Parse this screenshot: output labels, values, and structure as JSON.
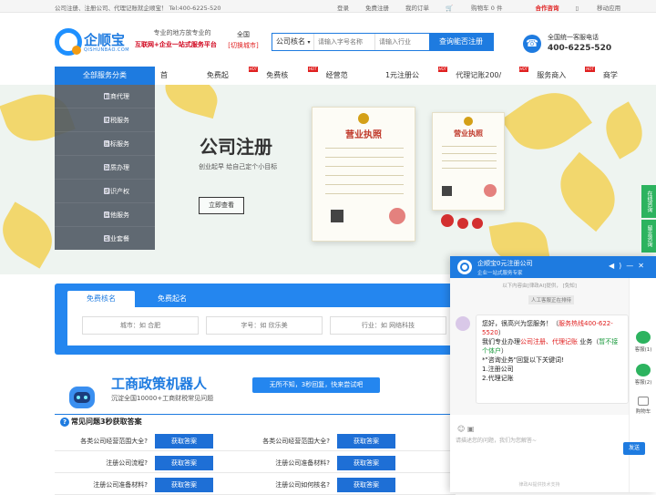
{
  "topbar": {
    "welcome": "公司注册、注册公司、代理记账就企顺宝！ Tel:400-6225-520",
    "links": [
      "登录",
      "免费注册",
      "我的订单",
      "购物车 0 件",
      "合作咨询",
      "移动应用"
    ]
  },
  "header": {
    "logo_title": "企顺宝",
    "logo_sub": "QISHUNBAO.COM",
    "slogan1": "专业的地方放专业的",
    "slogan2_red": "互联网+企业一站式服务平台",
    "city_name": "全国",
    "city_switch": "[切换城市]",
    "search_select": "公司核名",
    "search_ph1": "请输入字号名称",
    "search_ph2": "请输入行业",
    "search_btn": "查询能否注册",
    "phone_label": "全国统一客服电话",
    "phone_number": "400-6225-520"
  },
  "nav": {
    "category": "全部服务分类",
    "items": [
      {
        "label": "首页",
        "hot": ""
      },
      {
        "label": "免费起名",
        "hot": "HOT"
      },
      {
        "label": "免费核名",
        "hot": "HOT"
      },
      {
        "label": "经营范围",
        "hot": ""
      },
      {
        "label": "1元注册公司",
        "hot": "HOT"
      },
      {
        "label": "代理记账200/月",
        "hot": "HOT"
      },
      {
        "label": "服务商入口",
        "hot": "HOT"
      },
      {
        "label": "商学院",
        "hot": ""
      }
    ]
  },
  "sidemenu": [
    "工商代理",
    "财税服务",
    "商标服务",
    "资质办理",
    "知识产权",
    "其他服务",
    "创业套餐"
  ],
  "banner": {
    "title": "公司注册",
    "subtitle": "创业起早  给自己定个小目标",
    "button": "立即查看",
    "license_title": "营业执照"
  },
  "right_tabs": [
    "在线咨询",
    "留言咨询"
  ],
  "form": {
    "tabs": [
      "免费核名",
      "免费起名"
    ],
    "field1": "城市：如 合肥",
    "field2": "字号：如 欣乐美",
    "field3": "行业：如 网络科技",
    "field4": "有限"
  },
  "policy": {
    "title": "工商政策机器人",
    "subtitle": "沉淀全国10000+工商财税常见问题",
    "bubble": "无所不知，3秒回复，快来尝试吧"
  },
  "faq": {
    "header": "常见问题3秒获取答案",
    "rows": [
      {
        "q1": "各类公司经营范围大全?",
        "q2": "各类公司经营范围大全?",
        "btn": "获取答案"
      },
      {
        "q1": "注册公司流程?",
        "q2": "注册公司准备材料?",
        "btn": "获取答案"
      },
      {
        "q1": "注册公司准备材料?",
        "q2": "注册公司如何核名?",
        "btn": "获取答案"
      }
    ]
  },
  "chat": {
    "name": "企顺宝0元注册公司",
    "sub": "企业一站式服务专家",
    "sys1": "以下内容由[律政AI]提供，  [免知]",
    "sys2": "人工客服正在排待",
    "msg_a": "您好，很高兴为您服务！（",
    "msg_hotline": "服务热线400-622-5520",
    "msg_b": "）",
    "msg_c": "我们专业办理",
    "msg_red2": "公司注册、代理记账",
    "msg_d": " 业务（",
    "msg_grn": "暂不接个体户",
    "msg_e": "）",
    "msg_f": "*\"咨询业务\"回复以下关键词!",
    "opt1": "1.注册公司",
    "opt2": "2.代理记账",
    "side": [
      "客服(1)",
      "客服(2)",
      "购物车"
    ],
    "placeholder": "请描述您的问题，我们为您解答~",
    "send": "发送",
    "footer": "律政AI提供技术支持"
  }
}
